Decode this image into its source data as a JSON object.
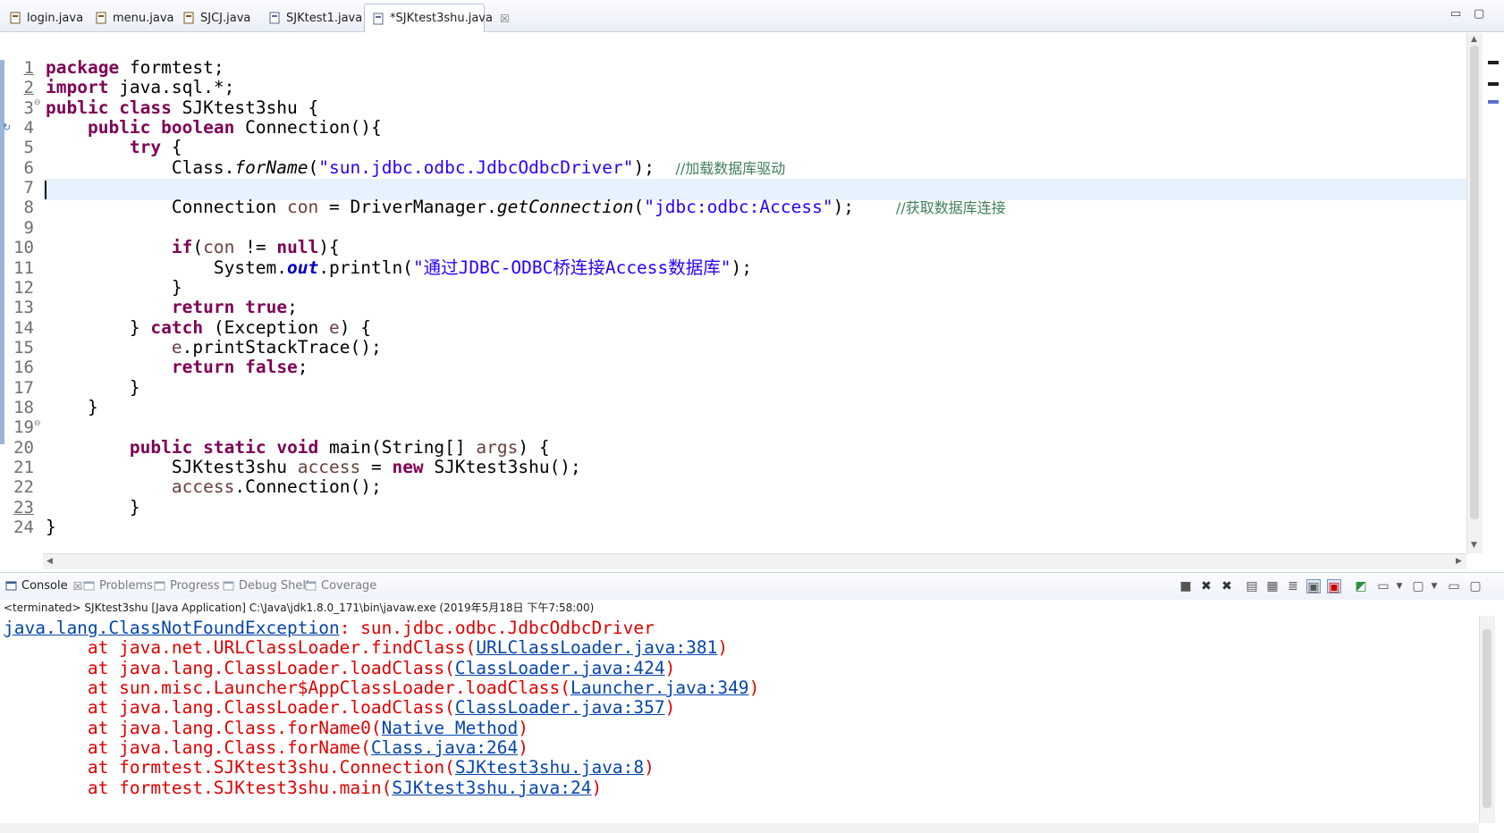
{
  "tabs": [
    {
      "label": "login.java",
      "icon": "java-class-icon"
    },
    {
      "label": "menu.java",
      "icon": "java-class-icon"
    },
    {
      "label": "SJCJ.java",
      "icon": "java-class-icon"
    },
    {
      "label": "SJKtest1.java",
      "icon": "java-file-icon"
    },
    {
      "label": "*SJKtest3shu.java",
      "icon": "java-file-icon",
      "active": true,
      "close": "☒"
    }
  ],
  "editor": {
    "line_numbers": [
      "1",
      "2",
      "3",
      "4",
      "5",
      "6",
      "7",
      "8",
      "9",
      "10",
      "11",
      "12",
      "13",
      "14",
      "15",
      "16",
      "17",
      "18",
      "19",
      "20",
      "21",
      "22",
      "23",
      "24"
    ],
    "lines": [
      [
        {
          "t": "package",
          "c": "kw"
        },
        {
          "t": " formtest;"
        }
      ],
      [
        {
          "t": "import",
          "c": "kw"
        },
        {
          "t": " java.sql.*;"
        }
      ],
      [
        {
          "t": "public",
          "c": "kw"
        },
        {
          "t": " "
        },
        {
          "t": "class",
          "c": "kw"
        },
        {
          "t": " SJKtest3shu {"
        }
      ],
      [
        {
          "t": "    "
        },
        {
          "t": "public",
          "c": "kw"
        },
        {
          "t": " "
        },
        {
          "t": "boolean",
          "c": "kw"
        },
        {
          "t": " Connection(){"
        }
      ],
      [
        {
          "t": "        "
        },
        {
          "t": "try",
          "c": "kw"
        },
        {
          "t": " {"
        }
      ],
      [
        {
          "t": "            Class."
        },
        {
          "t": "forName",
          "c": "it"
        },
        {
          "t": "("
        },
        {
          "t": "\"sun.jdbc.odbc.JdbcOdbcDriver\"",
          "c": "str"
        },
        {
          "t": ");  "
        },
        {
          "t": "//加载数据库驱动",
          "c": "cm"
        }
      ],
      [],
      [
        {
          "t": "            Connection "
        },
        {
          "t": "con",
          "c": "var"
        },
        {
          "t": " = DriverManager."
        },
        {
          "t": "getConnection",
          "c": "it"
        },
        {
          "t": "("
        },
        {
          "t": "\"jdbc:odbc:Access\"",
          "c": "str"
        },
        {
          "t": ");    "
        },
        {
          "t": "//获取数据库连接",
          "c": "cm"
        }
      ],
      [],
      [
        {
          "t": "            "
        },
        {
          "t": "if",
          "c": "kw"
        },
        {
          "t": "("
        },
        {
          "t": "con",
          "c": "var"
        },
        {
          "t": " != "
        },
        {
          "t": "null",
          "c": "kw"
        },
        {
          "t": "){"
        }
      ],
      [
        {
          "t": "                System."
        },
        {
          "t": "out",
          "c": "fld"
        },
        {
          "t": ".println("
        },
        {
          "t": "\"通过JDBC-ODBC桥连接Access数据库\"",
          "c": "str"
        },
        {
          "t": ");"
        }
      ],
      [
        {
          "t": "            }"
        }
      ],
      [
        {
          "t": "            "
        },
        {
          "t": "return",
          "c": "kw"
        },
        {
          "t": " "
        },
        {
          "t": "true",
          "c": "kw"
        },
        {
          "t": ";"
        }
      ],
      [
        {
          "t": "        } "
        },
        {
          "t": "catch",
          "c": "kw"
        },
        {
          "t": " (Exception "
        },
        {
          "t": "e",
          "c": "var"
        },
        {
          "t": ") {"
        }
      ],
      [
        {
          "t": "            "
        },
        {
          "t": "e",
          "c": "var"
        },
        {
          "t": ".printStackTrace();"
        }
      ],
      [
        {
          "t": "            "
        },
        {
          "t": "return",
          "c": "kw"
        },
        {
          "t": " "
        },
        {
          "t": "false",
          "c": "kw"
        },
        {
          "t": ";"
        }
      ],
      [
        {
          "t": "        }"
        }
      ],
      [
        {
          "t": "    }"
        }
      ],
      [],
      [
        {
          "t": "        "
        },
        {
          "t": "public",
          "c": "kw"
        },
        {
          "t": " "
        },
        {
          "t": "static",
          "c": "kw"
        },
        {
          "t": " "
        },
        {
          "t": "void",
          "c": "kw"
        },
        {
          "t": " main(String[] "
        },
        {
          "t": "args",
          "c": "var"
        },
        {
          "t": ") {"
        }
      ],
      [
        {
          "t": "            SJKtest3shu "
        },
        {
          "t": "access",
          "c": "var"
        },
        {
          "t": " = "
        },
        {
          "t": "new",
          "c": "kw"
        },
        {
          "t": " SJKtest3shu();"
        }
      ],
      [
        {
          "t": "            "
        },
        {
          "t": "access",
          "c": "var"
        },
        {
          "t": ".Connection();"
        }
      ],
      [
        {
          "t": "        }"
        }
      ],
      [
        {
          "t": "}"
        }
      ]
    ]
  },
  "console": {
    "tabs": [
      {
        "label": "Console",
        "icon": "console-icon",
        "active": true,
        "close": "☒"
      },
      {
        "label": "Problems",
        "icon": "problems-icon"
      },
      {
        "label": "Progress",
        "icon": "progress-icon"
      },
      {
        "label": "Debug Shell",
        "icon": "debug-shell-icon"
      },
      {
        "label": "Coverage",
        "icon": "coverage-icon"
      }
    ],
    "status": "<terminated> SJKtest3shu [Java Application] C:\\Java\\jdk1.8.0_171\\bin\\javaw.exe (2019年5月18日 下午7:58:00)",
    "lines": [
      [
        {
          "t": "java.lang.ClassNotFoundException",
          "c": "link"
        },
        {
          "t": ": sun.jdbc.odbc.JdbcOdbcDriver"
        }
      ],
      [
        {
          "t": "\tat java.net.URLClassLoader.findClass("
        },
        {
          "t": "URLClassLoader.java:381",
          "c": "link"
        },
        {
          "t": ")"
        }
      ],
      [
        {
          "t": "\tat java.lang.ClassLoader.loadClass("
        },
        {
          "t": "ClassLoader.java:424",
          "c": "link"
        },
        {
          "t": ")"
        }
      ],
      [
        {
          "t": "\tat sun.misc.Launcher$AppClassLoader.loadClass("
        },
        {
          "t": "Launcher.java:349",
          "c": "link"
        },
        {
          "t": ")"
        }
      ],
      [
        {
          "t": "\tat java.lang.ClassLoader.loadClass("
        },
        {
          "t": "ClassLoader.java:357",
          "c": "link"
        },
        {
          "t": ")"
        }
      ],
      [
        {
          "t": "\tat java.lang.Class.forName0("
        },
        {
          "t": "Native Method",
          "c": "link"
        },
        {
          "t": ")"
        }
      ],
      [
        {
          "t": "\tat java.lang.Class.forName("
        },
        {
          "t": "Class.java:264",
          "c": "link"
        },
        {
          "t": ")"
        }
      ],
      [
        {
          "t": "\tat formtest.SJKtest3shu.Connection("
        },
        {
          "t": "SJKtest3shu.java:8",
          "c": "link"
        },
        {
          "t": ")"
        }
      ],
      [
        {
          "t": "\tat formtest.SJKtest3shu.main("
        },
        {
          "t": "SJKtest3shu.java:24",
          "c": "link"
        },
        {
          "t": ")"
        }
      ]
    ]
  },
  "colors": {
    "keyword": "#7f0055",
    "string": "#2a00ff",
    "comment": "#3f7f5f",
    "error": "#e00000",
    "link": "#0645ad"
  }
}
